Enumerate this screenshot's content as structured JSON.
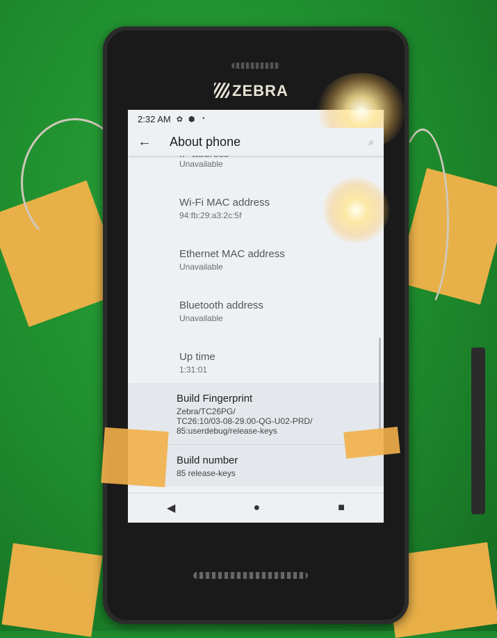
{
  "device": {
    "brand": "ZEBRA"
  },
  "status_bar": {
    "time": "2:32 AM",
    "icons": [
      "gear-icon",
      "shield-icon",
      "wifi-icon"
    ]
  },
  "app_bar": {
    "title": "About phone",
    "back_icon": "arrow-left-icon",
    "search_icon": "search-icon"
  },
  "items": [
    {
      "title": "IP address",
      "subtitle": "Unavailable"
    },
    {
      "title": "Wi-Fi MAC address",
      "subtitle": "94:fb:29:a3:2c:5f"
    },
    {
      "title": "Ethernet MAC address",
      "subtitle": "Unavailable"
    },
    {
      "title": "Bluetooth address",
      "subtitle": "Unavailable"
    },
    {
      "title": "Up time",
      "subtitle": "1:31:01"
    },
    {
      "title": "Build Fingerprint",
      "subtitle": "Zebra/TC26PG/\nTC26:10/03-08-29.00-QG-U02-PRD/\n85:userdebug/release-keys"
    },
    {
      "title": "Build number",
      "subtitle": "85 release-keys"
    }
  ],
  "nav_bar": {
    "back": "◀",
    "home": "●",
    "recents": "■"
  }
}
